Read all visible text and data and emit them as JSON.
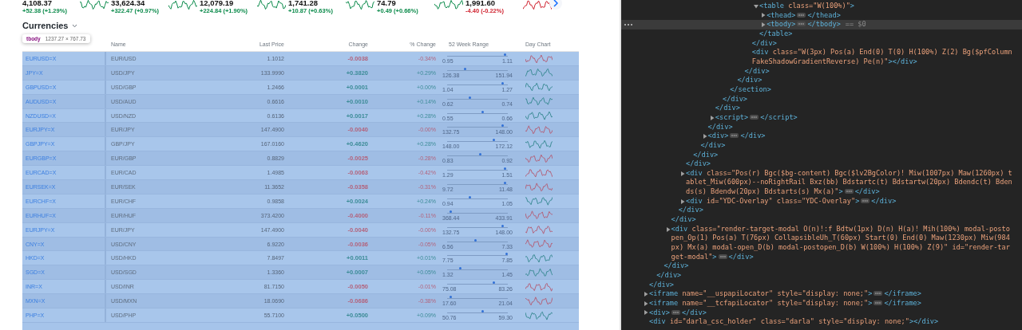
{
  "tickers": [
    {
      "value": "4,108.37",
      "change": "+52.38 (+1.29%)",
      "color": "#0a8a4a"
    },
    {
      "value": "33,624.34",
      "change": "+322.47 (+0.97%)",
      "color": "#0a8a4a"
    },
    {
      "value": "12,079.19",
      "change": "+224.84 (+1.90%)",
      "color": "#0a8a4a"
    },
    {
      "value": "1,741.28",
      "change": "+10.87 (+0.63%)",
      "color": "#0a8a4a"
    },
    {
      "value": "74.79",
      "change": "+0.49 (+0.66%)",
      "color": "#0a8a4a"
    },
    {
      "value": "1,991.60",
      "change": "-4.40 (-0.22%)",
      "color": "#d0222f"
    }
  ],
  "section": {
    "title": "Currencies"
  },
  "inspector_tooltip": {
    "tag": "tbody",
    "size": "1237.27 × 767.73"
  },
  "table": {
    "highlighted": true,
    "columns": [
      {
        "label": "Name"
      },
      {
        "label": "Last Price"
      },
      {
        "label": "Change"
      },
      {
        "label": "% Change"
      },
      {
        "label": "52 Week Range"
      },
      {
        "label": "Day Chart"
      }
    ],
    "rows": [
      {
        "symbol": "EURUSD=X",
        "name": "EUR/USD",
        "price": "1.1012",
        "change": "-0.0038",
        "pct": "-0.34%",
        "color": "#b3637c",
        "range_low": "0.95",
        "range_high": "1.11",
        "level": 0.95
      },
      {
        "symbol": "JPY=X",
        "name": "USD/JPY",
        "price": "133.9990",
        "change": "+0.3820",
        "pct": "+0.29%",
        "color": "#3d8c97",
        "range_low": "126.38",
        "range_high": "151.94",
        "level": 0.3
      },
      {
        "symbol": "GBPUSD=X",
        "name": "USD/GBP",
        "price": "1.2466",
        "change": "+0.0001",
        "pct": "+0.00%",
        "color": "#3d8c97",
        "range_low": "1.04",
        "range_high": "1.27",
        "level": 0.91
      },
      {
        "symbol": "AUDUSD=X",
        "name": "USD/AUD",
        "price": "0.6616",
        "change": "+0.0010",
        "pct": "+0.14%",
        "color": "#3d8c97",
        "range_low": "0.62",
        "range_high": "0.74",
        "level": 0.38
      },
      {
        "symbol": "NZDUSD=X",
        "name": "USD/NZD",
        "price": "0.6136",
        "change": "+0.0017",
        "pct": "+0.28%",
        "color": "#3d8c97",
        "range_low": "0.55",
        "range_high": "0.66",
        "level": 0.58
      },
      {
        "symbol": "EURJPY=X",
        "name": "EUR/JPY",
        "price": "147.4900",
        "change": "-0.0040",
        "pct": "-0.00%",
        "color": "#b3637c",
        "range_low": "132.75",
        "range_high": "148.00",
        "level": 0.92
      },
      {
        "symbol": "GBPJPY=X",
        "name": "GBP/JPY",
        "price": "167.0160",
        "change": "+0.4620",
        "pct": "+0.28%",
        "color": "#3d8c97",
        "range_low": "148.00",
        "range_high": "172.12",
        "level": 0.77
      },
      {
        "symbol": "EURGBP=X",
        "name": "EUR/GBP",
        "price": "0.8829",
        "change": "-0.0025",
        "pct": "-0.28%",
        "color": "#b3637c",
        "range_low": "0.83",
        "range_high": "0.92",
        "level": 0.55
      },
      {
        "symbol": "EURCAD=X",
        "name": "EUR/CAD",
        "price": "1.4985",
        "change": "-0.0063",
        "pct": "-0.42%",
        "color": "#b3637c",
        "range_low": "1.29",
        "range_high": "1.51",
        "level": 0.95
      },
      {
        "symbol": "EURSEK=X",
        "name": "EUR/SEK",
        "price": "11.3652",
        "change": "-0.0358",
        "pct": "-0.31%",
        "color": "#b3637c",
        "range_low": "9.72",
        "range_high": "11.48",
        "level": 0.96
      },
      {
        "symbol": "EURCHF=X",
        "name": "EUR/CHF",
        "price": "0.9858",
        "change": "+0.0024",
        "pct": "+0.24%",
        "color": "#3d8c97",
        "range_low": "0.94",
        "range_high": "1.05",
        "level": 0.38
      },
      {
        "symbol": "EURHUF=X",
        "name": "EUR/HUF",
        "price": "373.4200",
        "change": "-0.4000",
        "pct": "-0.11%",
        "color": "#b3637c",
        "range_low": "368.44",
        "range_high": "433.91",
        "level": 0.06
      },
      {
        "symbol": "EURJPY=X",
        "name": "EUR/JPY",
        "price": "147.4900",
        "change": "-0.0040",
        "pct": "-0.00%",
        "color": "#b3637c",
        "range_low": "132.75",
        "range_high": "148.00",
        "level": 0.92
      },
      {
        "symbol": "CNY=X",
        "name": "USD/CNY",
        "price": "6.9220",
        "change": "-0.0036",
        "pct": "-0.05%",
        "color": "#b3637c",
        "range_low": "6.56",
        "range_high": "7.33",
        "level": 0.47
      },
      {
        "symbol": "HKD=X",
        "name": "USD/HKD",
        "price": "7.8497",
        "change": "+0.0011",
        "pct": "+0.01%",
        "color": "#3d8c97",
        "range_low": "7.75",
        "range_high": "7.85",
        "level": 0.98
      },
      {
        "symbol": "SGD=X",
        "name": "USD/SGD",
        "price": "1.3360",
        "change": "+0.0007",
        "pct": "+0.05%",
        "color": "#3d8c97",
        "range_low": "1.32",
        "range_high": "1.45",
        "level": 0.22
      },
      {
        "symbol": "INR=X",
        "name": "USD/INR",
        "price": "81.7150",
        "change": "-0.0050",
        "pct": "-0.01%",
        "color": "#b3637c",
        "range_low": "75.08",
        "range_high": "83.26",
        "level": 0.77
      },
      {
        "symbol": "MXN=X",
        "name": "USD/MXN",
        "price": "18.0690",
        "change": "-0.0686",
        "pct": "-0.38%",
        "color": "#b3637c",
        "range_low": "17.60",
        "range_high": "21.04",
        "level": 0.06
      },
      {
        "symbol": "PHP=X",
        "name": "USD/PHP",
        "price": "55.7100",
        "change": "+0.0500",
        "pct": "+0.09%",
        "color": "#3d8c97",
        "range_low": "50.76",
        "range_high": "59.30",
        "level": 0.58
      }
    ]
  },
  "devtools": {
    "nodes": [
      {
        "close": "</div>",
        "children": [
          {
            "close": "</div>",
            "children": [
              {
                "close": "</div>",
                "children": [
                  {
                    "close": "</div>",
                    "children": [
                      {
                        "close": "</div>",
                        "children": [
                          {
                            "close": "</div>",
                            "children": [
                              {
                                "close": "</div>",
                                "children": [
                                  {
                                    "close": "</div>",
                                    "children": [
                                      {
                                        "close": "</div>",
                                        "children": [
                                          {
                                            "close": "</div>",
                                            "children": [
                                              {
                                                "close": "</div>",
                                                "children": [
                                                  {
                                                    "close": "</section>",
                                                    "children": [
                                                      {
                                                        "close": "</div>",
                                                        "children": [
                                                          {
                                                            "close": "</div>",
                                                            "children": [
                                                              {
                                                                "close": "</div>",
                                                                "children": [
                                                                  {
                                                                    "text": "<table class=\"W(100%)\">",
                                                                    "close": "</table>",
                                                                    "expanded": true,
                                                                    "selected": false,
                                                                    "children": [
                                                                      {
                                                                        "text": "<thead>",
                                                                        "close": "</thead>",
                                                                        "expanded": false,
                                                                        "selected": false
                                                                      },
                                                                      {
                                                                        "text": "<tbody>",
                                                                        "close": "</tbody>",
                                                                        "expanded": false,
                                                                        "selected": true,
                                                                        "marker": "== $0"
                                                                      }
                                                                    ]
                                                                  }
                                                                ]
                                                              },
                                                              {
                                                                "text": "<div class=\"W(3px) Pos(a) End(0) T(0) H(100%) Z(2) Bg($pfColumnFakeShadowGradientReverse) Pe(n)\">",
                                                                "close": "</div>",
                                                                "selected": false
                                                              }
                                                            ]
                                                          }
                                                        ]
                                                      }
                                                    ]
                                                  }
                                                ]
                                              }
                                            ]
                                          },
                                          {
                                            "text": "<script>",
                                            "close": "</script>",
                                            "expanded": false,
                                            "selected": false
                                          }
                                        ]
                                      },
                                      {
                                        "text": "<div>",
                                        "close": "</div>",
                                        "expanded": false,
                                        "selected": false
                                      }
                                    ]
                                  }
                                ]
                              }
                            ]
                          },
                          {
                            "text": "<div class=\"Pos(r) Bgc($bg-content) Bgc($lv2BgColor)! Miw(1007px) Maw(1260px) tablet_Miw(600px)--noRightRail Bxz(bb) Bdstartc(t) Bdstartw(20px) Bdendc(t) Bdends(s) Bdendw(20px) Bdstarts(s) Mx(a)\">",
                            "close": "</div>",
                            "expanded": false,
                            "selected": false
                          },
                          {
                            "text": "<div id=\"YDC-Overlay\" class=\"YDC-Overlay\">",
                            "close": "</div>",
                            "expanded": false,
                            "selected": false
                          }
                        ]
                      }
                    ]
                  },
                  {
                    "text": "<div class=\"render-target-modal O(n)!:f Bdtw(1px) D(n) H(a)! Mih(100%) modal-postopen_Op(1) Pos(a) T(76px) CollapsibleUh_T(60px) Start(0) End(0) Maw(1230px) Miw(984px) Mx(a) modal-open_D(b) modal-postopen_D(b) W(100%) H(100%) Z(9)\" id=\"render-target-modal\">",
                    "close": "</div>",
                    "expanded": false,
                    "selected": false
                  }
                ]
              }
            ]
          }
        ]
      },
      {
        "text": "<iframe name=\"__uspapiLocator\" style=\"display: none;\">",
        "close": "</iframe>",
        "expanded": false,
        "selected": false
      },
      {
        "text": "<iframe name=\"__tcfapiLocator\" style=\"display: none;\">",
        "close": "</iframe>",
        "expanded": false,
        "selected": false
      },
      {
        "text": "<div>",
        "close": "</div>",
        "expanded": false,
        "selected": false
      },
      {
        "text": "<div id=\"darla_csc_holder\" class=\"darla\" style=\"display: none;\">",
        "close": "</div>",
        "selected": false
      }
    ]
  }
}
